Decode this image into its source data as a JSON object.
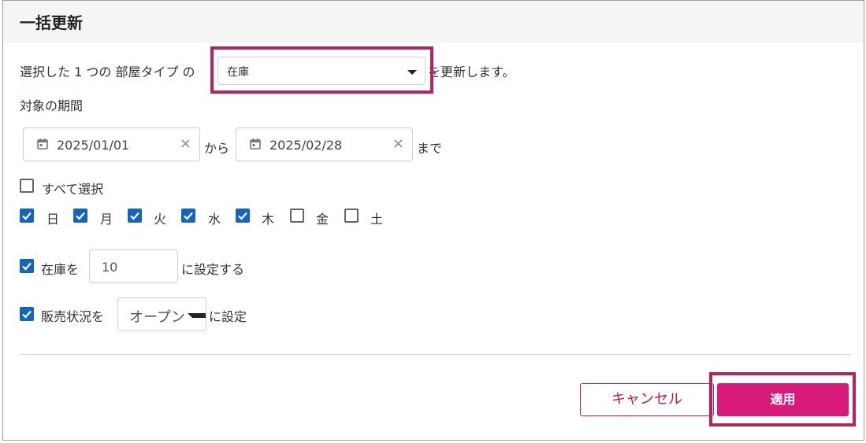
{
  "dialog": {
    "title": "一括更新"
  },
  "intro": {
    "prefix": "選択した 1 つの 部屋タイプ の",
    "selected_field": "在庫",
    "suffix": "を更新します。"
  },
  "period": {
    "label": "対象の期間",
    "start_date": "2025/01/01",
    "from_label": "から",
    "end_date": "2025/02/28",
    "until_label": "まで",
    "clear_glyph": "×"
  },
  "days": {
    "select_all_label": "すべて選択",
    "select_all_checked": false,
    "items": [
      {
        "label": "日",
        "checked": true
      },
      {
        "label": "月",
        "checked": true
      },
      {
        "label": "火",
        "checked": true
      },
      {
        "label": "水",
        "checked": true
      },
      {
        "label": "木",
        "checked": true
      },
      {
        "label": "金",
        "checked": false
      },
      {
        "label": "土",
        "checked": false
      }
    ]
  },
  "stock": {
    "checked": true,
    "prefix": "在庫を",
    "value": "10",
    "suffix": "に設定する"
  },
  "sales_status": {
    "checked": true,
    "prefix": "販売状況を",
    "value": "オープン",
    "suffix": "に設定"
  },
  "buttons": {
    "cancel": "キャンセル",
    "apply": "適用"
  },
  "colors": {
    "accent": "#d81b7a",
    "highlight": "#b5245f",
    "checkbox": "#1565c0"
  }
}
